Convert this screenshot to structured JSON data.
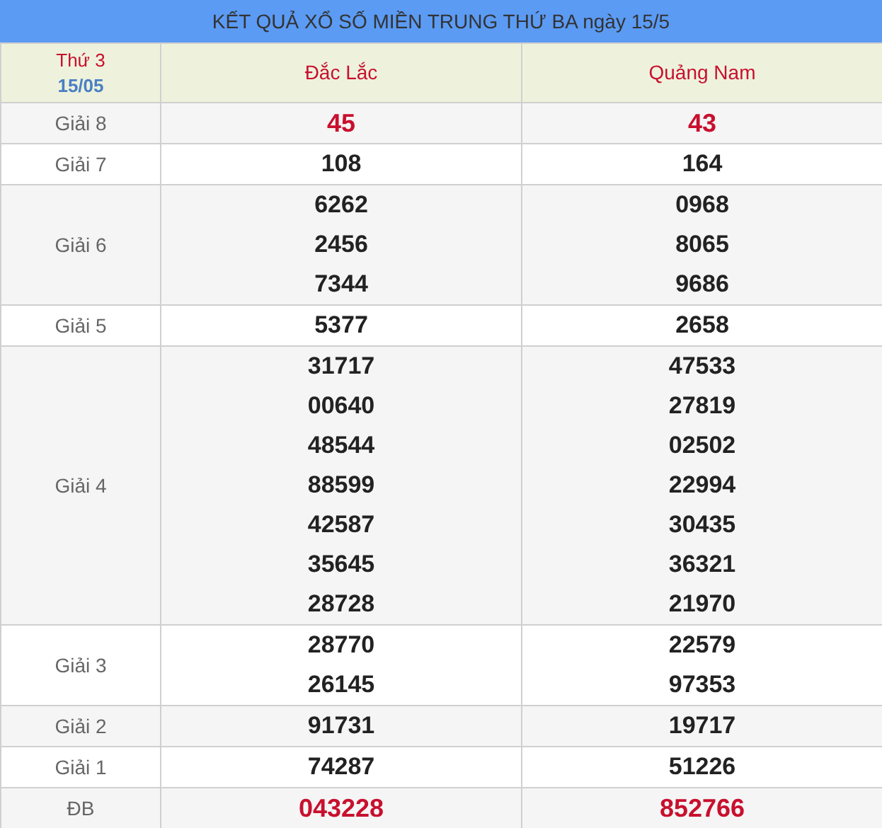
{
  "title": "KẾT QUẢ XỔ SỐ MIỀN TRUNG THỨ BA ngày 15/5",
  "header": {
    "weekday": "Thứ 3",
    "date": "15/05",
    "provinces": [
      "Đắc Lắc",
      "Quảng Nam"
    ]
  },
  "rows": [
    {
      "label": "Giải 8",
      "kind": "highlight",
      "values": [
        [
          "45"
        ],
        [
          "43"
        ]
      ]
    },
    {
      "label": "Giải 7",
      "kind": "normal",
      "values": [
        [
          "108"
        ],
        [
          "164"
        ]
      ]
    },
    {
      "label": "Giải 6",
      "kind": "normal",
      "values": [
        [
          "6262",
          "2456",
          "7344"
        ],
        [
          "0968",
          "8065",
          "9686"
        ]
      ]
    },
    {
      "label": "Giải 5",
      "kind": "normal",
      "values": [
        [
          "5377"
        ],
        [
          "2658"
        ]
      ]
    },
    {
      "label": "Giải 4",
      "kind": "normal",
      "values": [
        [
          "31717",
          "00640",
          "48544",
          "88599",
          "42587",
          "35645",
          "28728"
        ],
        [
          "47533",
          "27819",
          "02502",
          "22994",
          "30435",
          "36321",
          "21970"
        ]
      ]
    },
    {
      "label": "Giải 3",
      "kind": "normal",
      "values": [
        [
          "28770",
          "26145"
        ],
        [
          "22579",
          "97353"
        ]
      ]
    },
    {
      "label": "Giải 2",
      "kind": "normal",
      "values": [
        [
          "91731"
        ],
        [
          "19717"
        ]
      ]
    },
    {
      "label": "Giải 1",
      "kind": "normal",
      "values": [
        [
          "74287"
        ],
        [
          "51226"
        ]
      ]
    },
    {
      "label": "ĐB",
      "kind": "highlight",
      "values": [
        [
          "043228"
        ],
        [
          "852766"
        ]
      ]
    }
  ]
}
